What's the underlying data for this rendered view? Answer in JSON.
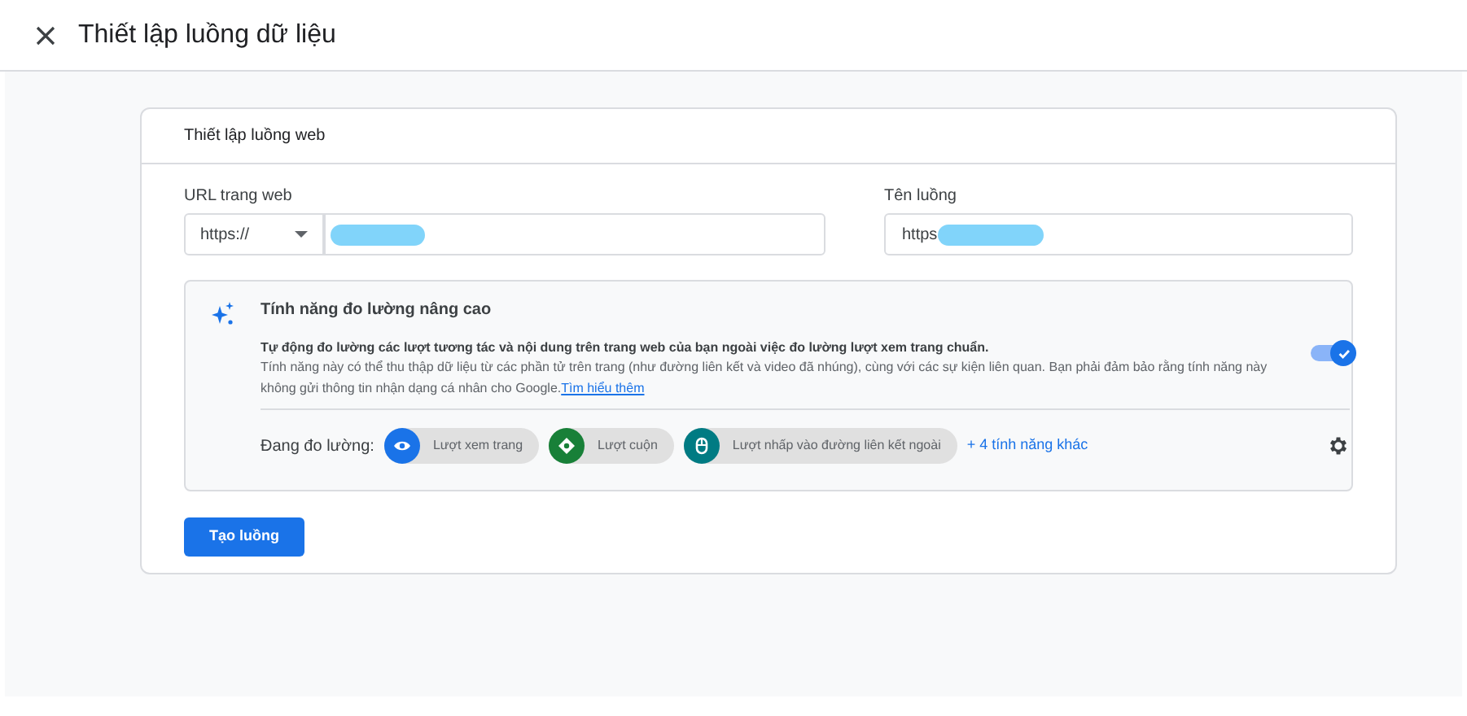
{
  "window": {
    "title": "Thiết lập luồng dữ liệu"
  },
  "card": {
    "title": "Thiết lập luồng web",
    "url_field": {
      "label": "URL trang web",
      "protocol": "https://"
    },
    "name_field": {
      "label": "Tên luồng",
      "value": "https"
    },
    "enhanced": {
      "title": "Tính năng đo lường nâng cao",
      "lead": "Tự động đo lường các lượt tương tác và nội dung trên trang web của bạn ngoài việc đo lường lượt xem trang chuẩn.",
      "body": "Tính năng này có thể thu thập dữ liệu từ các phần tử trên trang (như đường liên kết và video đã nhúng), cùng với các sự kiện liên quan. Bạn phải đảm bảo rằng tính năng này không gửi thông tin nhận dạng cá nhân cho Google.",
      "link": "Tìm hiểu thêm",
      "on": true,
      "measuring_label": "Đang đo lường:",
      "chips": [
        {
          "label": "Lượt xem trang",
          "kind": "eye",
          "color": "#1a73e8"
        },
        {
          "label": "Lượt cuộn",
          "kind": "scroll",
          "color": "#188038"
        },
        {
          "label": "Lượt nhấp vào đường liên kết ngoài",
          "kind": "mouse",
          "color": "#007b83"
        }
      ],
      "more": "+ 4 tính năng khác"
    },
    "submit": "Tạo luồng"
  }
}
